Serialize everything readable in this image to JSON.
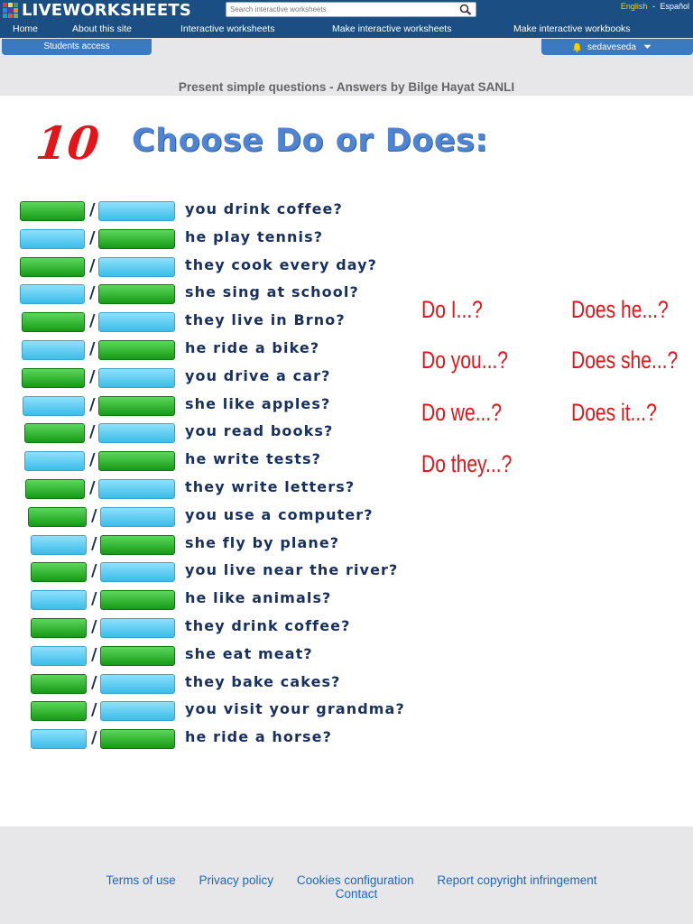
{
  "site": {
    "logo_text": "LIVEWORKSHEETS",
    "logo_colors": [
      "#e53935",
      "#fdd835",
      "#43a047",
      "#1e88e5",
      "#8e24aa",
      "#fb8c00",
      "#00acc1",
      "#f4511e",
      "#7cb342"
    ],
    "search_placeholder": "Search interactive worksheets",
    "lang_english": "English",
    "lang_sep": "-",
    "lang_spanish": "Español"
  },
  "nav": {
    "home": "Home",
    "about": "About this site",
    "interactive": "Interactive worksheets",
    "make_worksheets": "Make interactive worksheets",
    "make_workbooks": "Make interactive workbooks"
  },
  "students_access": "Students access",
  "username": "sedaveseda",
  "page_subtitle": "Present simple questions - Answers by Bilge Hayat SANLI",
  "worksheet": {
    "number": "10",
    "title": "Choose Do or Does:",
    "slash": "/",
    "sentences": [
      "you drink coffee?",
      "he play tennis?",
      "they cook every day?",
      "she sing at school?",
      "they live in Brno?",
      "he ride a bike?",
      "you drive a car?",
      "she like apples?",
      "you read books?",
      "he write tests?",
      "they write letters?",
      "you use a computer?",
      "she fly by plane?",
      "you live near the river?",
      "he like animals?",
      "they drink coffee?",
      "she eat meat?",
      "they bake cakes?",
      "you visit your grandma?",
      "he ride a horse?"
    ],
    "hints_do": [
      "Do I...?",
      "Do you...?",
      "Do we...?",
      "Do they...?"
    ],
    "hints_does": [
      "Does he...?",
      "Does she...?",
      "Does it...?"
    ],
    "colors": {
      "green": "#22a722",
      "blue": "#5cc8ef",
      "hint_red": "#e2151b",
      "title_blue": "#4f84d3"
    }
  },
  "footer": {
    "terms": "Terms of use",
    "privacy": "Privacy policy",
    "cookies": "Cookies configuration",
    "report": "Report copyright infringement",
    "contact": "Contact"
  }
}
